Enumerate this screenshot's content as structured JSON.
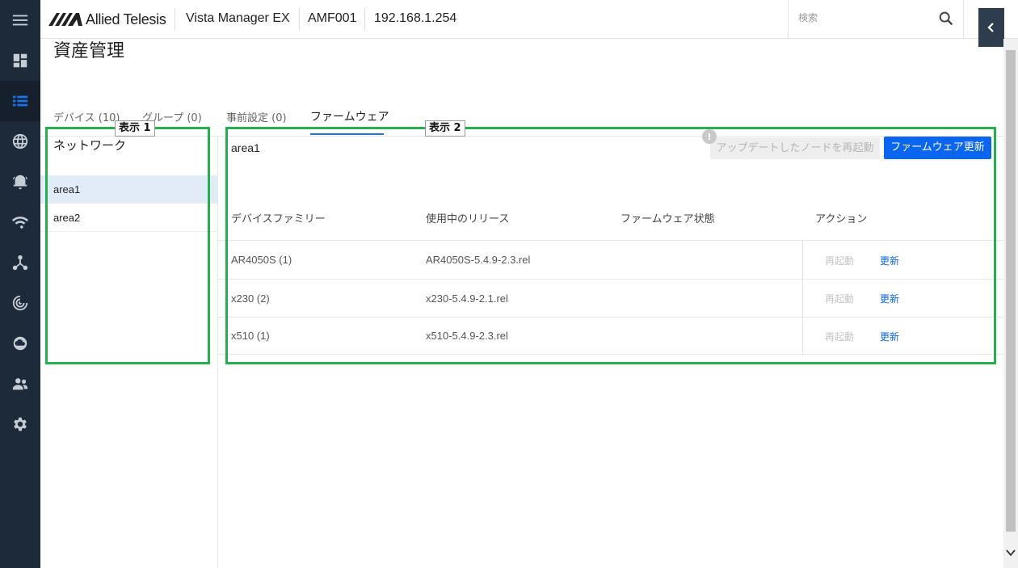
{
  "header": {
    "brand": "Allied Telesis",
    "product": "Vista Manager EX",
    "network": "AMF001",
    "ip": "192.168.1.254",
    "search_placeholder": "検索"
  },
  "nav": {
    "items": [
      {
        "icon": "dashboard-icon"
      },
      {
        "icon": "list-icon",
        "active": true
      },
      {
        "icon": "globe-icon"
      },
      {
        "icon": "alarm-icon"
      },
      {
        "icon": "wifi-icon"
      },
      {
        "icon": "topology-icon"
      },
      {
        "icon": "radar-icon"
      },
      {
        "icon": "cloud-icon"
      },
      {
        "icon": "users-icon"
      },
      {
        "icon": "gear-icon"
      }
    ]
  },
  "page": {
    "title": "資産管理",
    "tabs": [
      {
        "label": "デバイス (10)"
      },
      {
        "label": "グループ (0)"
      },
      {
        "label": "事前設定 (0)"
      },
      {
        "label": "ファームウェア",
        "active": true
      }
    ]
  },
  "left_panel": {
    "title": "ネットワーク",
    "items": [
      {
        "label": "area1",
        "selected": true
      },
      {
        "label": "area2"
      }
    ]
  },
  "main": {
    "area_title": "area1",
    "restart_all_label": "アップデートしたノードを再起動",
    "firmware_update_label": "ファームウェア更新",
    "columns": [
      "デバイスファミリー",
      "使用中のリリース",
      "ファームウェア状態",
      "アクション"
    ],
    "rows": [
      {
        "family": "AR4050S (1)",
        "release": "AR4050S-5.4.9-2.3.rel",
        "status": "",
        "restart": "再起動",
        "update": "更新"
      },
      {
        "family": "x230 (2)",
        "release": "x230-5.4.9-2.1.rel",
        "status": "",
        "restart": "再起動",
        "update": "更新"
      },
      {
        "family": "x510 (1)",
        "release": "x510-5.4.9-2.3.rel",
        "status": "",
        "restart": "再起動",
        "update": "更新"
      }
    ]
  },
  "annotations": {
    "box1_label": "表示 1",
    "box2_label": "表示 2",
    "box_color": "#22b14c"
  },
  "colors": {
    "nav_bg": "#1c2a3a",
    "accent": "#0a66f0"
  }
}
